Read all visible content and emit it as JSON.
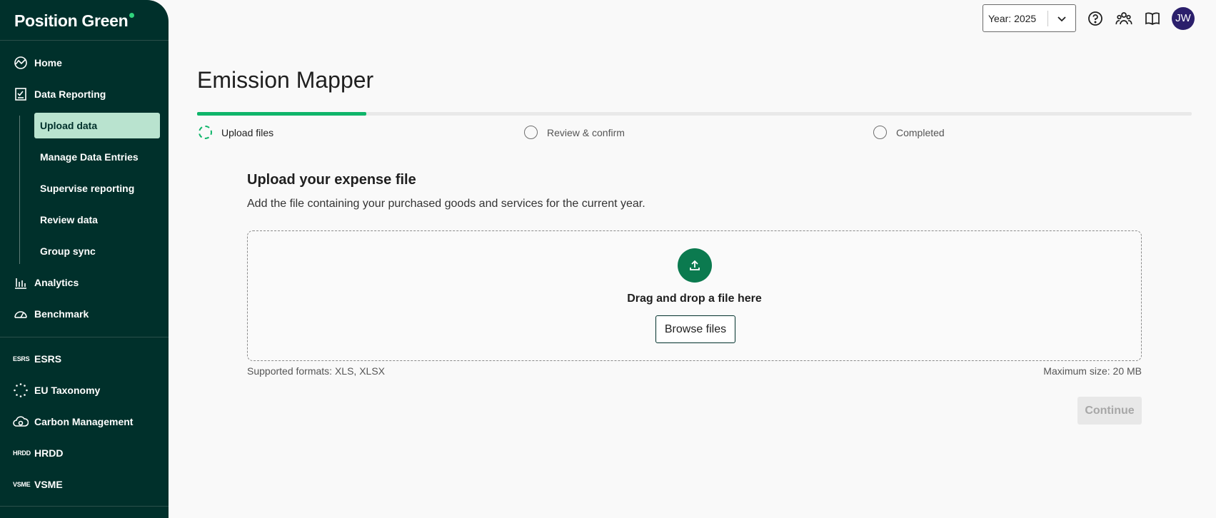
{
  "brand": {
    "name": "Position Green",
    "accent": "#2fd27c",
    "sidebar_bg": "#00302b"
  },
  "sidebar": {
    "items": [
      {
        "label": "Home",
        "icon": "home-icon"
      },
      {
        "label": "Data Reporting",
        "icon": "clipboard-check-icon"
      }
    ],
    "sub_items": [
      {
        "label": "Upload data",
        "active": true
      },
      {
        "label": "Manage Data Entries"
      },
      {
        "label": "Supervise reporting"
      },
      {
        "label": "Review data"
      },
      {
        "label": "Group sync"
      }
    ],
    "items_after": [
      {
        "label": "Analytics",
        "icon": "bar-chart-icon"
      },
      {
        "label": "Benchmark",
        "icon": "gauge-icon"
      }
    ],
    "modules": [
      {
        "abbr": "ESRS",
        "label": "ESRS"
      },
      {
        "abbr": "",
        "label": "EU Taxonomy",
        "icon": "eu-stars-icon"
      },
      {
        "abbr": "",
        "label": "Carbon Management",
        "icon": "carbon-cloud-icon"
      },
      {
        "abbr": "HRDD",
        "label": "HRDD"
      },
      {
        "abbr": "VSME",
        "label": "VSME"
      }
    ]
  },
  "topbar": {
    "year_label": "Year: 2025",
    "avatar_initials": "JW",
    "avatar_color": "#2b1f6b"
  },
  "main": {
    "title": "Emission Mapper",
    "progress": 0.17,
    "steps": [
      {
        "label": "Upload files",
        "state": "current"
      },
      {
        "label": "Review & confirm",
        "state": "pending"
      },
      {
        "label": "Completed",
        "state": "pending"
      }
    ],
    "section_title": "Upload your expense file",
    "section_desc": "Add the file containing your purchased goods and services for the current year.",
    "dropzone": {
      "drag_text": "Drag and drop a file here",
      "browse_label": "Browse files"
    },
    "supported_formats": "Supported formats: XLS, XLSX",
    "max_size": "Maximum size: 20 MB",
    "continue_label": "Continue"
  }
}
